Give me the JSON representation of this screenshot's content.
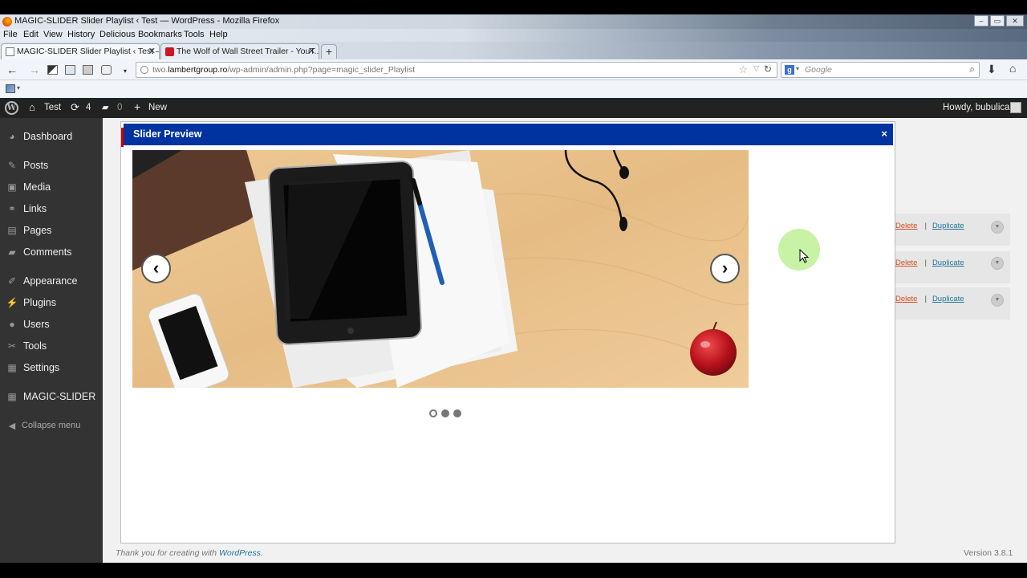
{
  "browser": {
    "window_title": "MAGIC-SLIDER Slider Playlist ‹ Test — WordPress - Mozilla Firefox",
    "menu": [
      "File",
      "Edit",
      "View",
      "History",
      "Delicious",
      "Bookmarks",
      "Tools",
      "Help"
    ],
    "tabs": [
      {
        "label": "MAGIC-SLIDER Slider Playlist ‹ Test —...",
        "favicon": "page-icon",
        "active": true
      },
      {
        "label": "The Wolf of Wall Street Trailer - YouT...",
        "favicon": "youtube-icon",
        "active": false
      }
    ],
    "url_prefix": "two.",
    "url_domain": "lambertgroup.ro",
    "url_path": "/wp-admin/admin.php?page=magic_slider_Playlist",
    "search_placeholder": "Google"
  },
  "adminbar": {
    "site_name": "Test",
    "updates_count": "4",
    "comments_count": "0",
    "new_label": "New",
    "greeting": "Howdy, bubulica"
  },
  "sidebar": {
    "items": [
      {
        "label": "Dashboard",
        "icon": "dashboard-icon",
        "glyph": "◕"
      },
      {
        "label": "Posts",
        "icon": "pin-icon",
        "glyph": "✎"
      },
      {
        "label": "Media",
        "icon": "media-icon",
        "glyph": "▣"
      },
      {
        "label": "Links",
        "icon": "link-icon",
        "glyph": "⚭"
      },
      {
        "label": "Pages",
        "icon": "pages-icon",
        "glyph": "▤"
      },
      {
        "label": "Comments",
        "icon": "comment-icon",
        "glyph": "▰"
      },
      {
        "label": "Appearance",
        "icon": "brush-icon",
        "glyph": "✐"
      },
      {
        "label": "Plugins",
        "icon": "plug-icon",
        "glyph": "⚡"
      },
      {
        "label": "Users",
        "icon": "user-icon",
        "glyph": "●"
      },
      {
        "label": "Tools",
        "icon": "wrench-icon",
        "glyph": "✂"
      },
      {
        "label": "Settings",
        "icon": "settings-icon",
        "glyph": "▦"
      },
      {
        "label": "MAGIC-SLIDER",
        "icon": "plugin-menu-icon",
        "glyph": "▦"
      }
    ],
    "collapse_label": "Collapse menu"
  },
  "rows": [
    {
      "delete": "Delete",
      "separator": "|",
      "duplicate": "Duplicate"
    },
    {
      "delete": "Delete",
      "separator": "|",
      "duplicate": "Duplicate"
    },
    {
      "delete": "Delete",
      "separator": "|",
      "duplicate": "Duplicate"
    }
  ],
  "modal": {
    "title": "Slider Preview",
    "close": "×",
    "prev": "‹",
    "next": "›",
    "bullets": {
      "count": 3,
      "active_index": 0
    }
  },
  "footer": {
    "thanks_prefix": "Thank you for creating with ",
    "thanks_link": "WordPress",
    "thanks_suffix": ".",
    "version": "Version 3.8.1"
  },
  "colors": {
    "modal_header": "#0033a0",
    "sidebar": "#333333",
    "adminbar": "#222222",
    "delete_link": "#d54e21",
    "duplicate_link": "#21759b"
  }
}
